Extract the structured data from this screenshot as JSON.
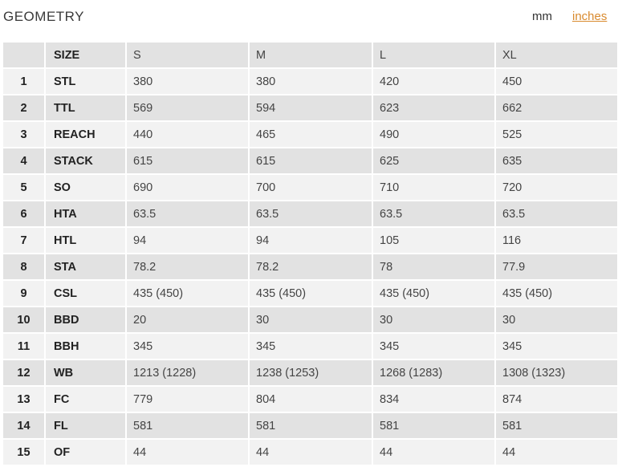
{
  "header": {
    "title": "GEOMETRY",
    "unit_mm": "mm",
    "unit_inches": "inches",
    "link_color": "#d98a2e"
  },
  "table": {
    "columns": [
      "SIZE",
      "S",
      "M",
      "L",
      "XL"
    ],
    "rows": [
      {
        "num": "1",
        "label": "STL",
        "values": [
          "380",
          "380",
          "420",
          "450"
        ]
      },
      {
        "num": "2",
        "label": "TTL",
        "values": [
          "569",
          "594",
          "623",
          "662"
        ]
      },
      {
        "num": "3",
        "label": "REACH",
        "values": [
          "440",
          "465",
          "490",
          "525"
        ]
      },
      {
        "num": "4",
        "label": "STACK",
        "values": [
          "615",
          "615",
          "625",
          "635"
        ]
      },
      {
        "num": "5",
        "label": "SO",
        "values": [
          "690",
          "700",
          "710",
          "720"
        ]
      },
      {
        "num": "6",
        "label": "HTA",
        "values": [
          "63.5",
          "63.5",
          "63.5",
          "63.5"
        ]
      },
      {
        "num": "7",
        "label": "HTL",
        "values": [
          "94",
          "94",
          "105",
          "116"
        ]
      },
      {
        "num": "8",
        "label": "STA",
        "values": [
          "78.2",
          "78.2",
          "78",
          "77.9"
        ]
      },
      {
        "num": "9",
        "label": "CSL",
        "values": [
          "435 (450)",
          "435 (450)",
          "435 (450)",
          "435 (450)"
        ]
      },
      {
        "num": "10",
        "label": "BBD",
        "values": [
          "20",
          "30",
          "30",
          "30"
        ]
      },
      {
        "num": "11",
        "label": "BBH",
        "values": [
          "345",
          "345",
          "345",
          "345"
        ]
      },
      {
        "num": "12",
        "label": "WB",
        "values": [
          "1213 (1228)",
          "1238 (1253)",
          "1268 (1283)",
          "1308 (1323)"
        ]
      },
      {
        "num": "13",
        "label": "FC",
        "values": [
          "779",
          "804",
          "834",
          "874"
        ]
      },
      {
        "num": "14",
        "label": "FL",
        "values": [
          "581",
          "581",
          "581",
          "581"
        ]
      },
      {
        "num": "15",
        "label": "OF",
        "values": [
          "44",
          "44",
          "44",
          "44"
        ]
      }
    ]
  }
}
